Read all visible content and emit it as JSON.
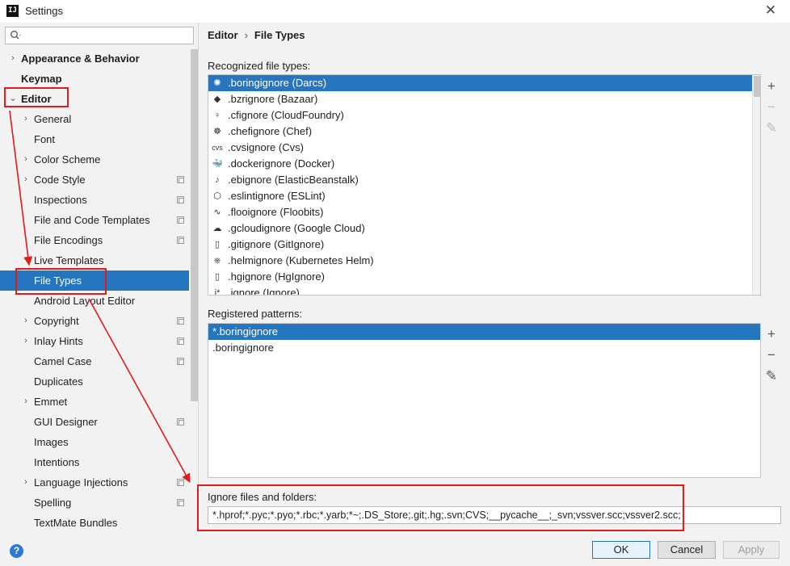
{
  "window": {
    "title": "Settings",
    "app_icon_text": "IJ"
  },
  "search": {
    "placeholder": ""
  },
  "sidebar": {
    "items": [
      {
        "label": "Appearance & Behavior",
        "arrow": "›",
        "bold": true
      },
      {
        "label": "Keymap",
        "bold": true
      },
      {
        "label": "Editor",
        "arrow": "⌄",
        "bold": true
      },
      {
        "label": "General",
        "arrow": "›"
      },
      {
        "label": "Font"
      },
      {
        "label": "Color Scheme",
        "arrow": "›"
      },
      {
        "label": "Code Style",
        "arrow": "›",
        "copy": true
      },
      {
        "label": "Inspections",
        "copy": true
      },
      {
        "label": "File and Code Templates",
        "copy": true
      },
      {
        "label": "File Encodings",
        "copy": true
      },
      {
        "label": "Live Templates"
      },
      {
        "label": "File Types",
        "selected": true
      },
      {
        "label": "Android Layout Editor"
      },
      {
        "label": "Copyright",
        "arrow": "›",
        "copy": true
      },
      {
        "label": "Inlay Hints",
        "arrow": "›",
        "copy": true
      },
      {
        "label": "Camel Case",
        "copy": true
      },
      {
        "label": "Duplicates"
      },
      {
        "label": "Emmet",
        "arrow": "›"
      },
      {
        "label": "GUI Designer",
        "copy": true
      },
      {
        "label": "Images"
      },
      {
        "label": "Intentions"
      },
      {
        "label": "Language Injections",
        "arrow": "›",
        "copy": true
      },
      {
        "label": "Spelling",
        "copy": true
      },
      {
        "label": "TextMate Bundles"
      }
    ]
  },
  "breadcrumb": {
    "parent": "Editor",
    "separator": "›",
    "current": "File Types"
  },
  "recognized": {
    "label": "Recognized file types:",
    "items": [
      {
        "icon": "✺",
        "icon_name": "darcs-icon",
        "label": ".boringignore (Darcs)",
        "selected": true
      },
      {
        "icon": "◆",
        "icon_name": "bazaar-icon",
        "label": ".bzrignore (Bazaar)"
      },
      {
        "icon": "♀",
        "icon_name": "cloudfoundry-icon",
        "label": ".cfignore (CloudFoundry)"
      },
      {
        "icon": "☸",
        "icon_name": "chef-icon",
        "label": ".chefignore (Chef)"
      },
      {
        "icon": "cvs",
        "icon_name": "cvs-icon",
        "label": ".cvsignore (Cvs)"
      },
      {
        "icon": "🐳",
        "icon_name": "docker-icon",
        "label": ".dockerignore (Docker)"
      },
      {
        "icon": "♪",
        "icon_name": "elasticbeanstalk-icon",
        "label": ".ebignore (ElasticBeanstalk)"
      },
      {
        "icon": "⬡",
        "icon_name": "eslint-icon",
        "label": ".eslintignore (ESLint)"
      },
      {
        "icon": "∿",
        "icon_name": "floobits-icon",
        "label": ".flooignore (Floobits)"
      },
      {
        "icon": "☁",
        "icon_name": "google-cloud-icon",
        "label": ".gcloudignore (Google Cloud)"
      },
      {
        "icon": "▯",
        "icon_name": "gitignore-icon",
        "label": ".gitignore (GitIgnore)"
      },
      {
        "icon": "⎈",
        "icon_name": "helm-icon",
        "label": ".helmignore (Kubernetes Helm)"
      },
      {
        "icon": "▯",
        "icon_name": "hgignore-icon",
        "label": ".hgignore (HgIgnore)"
      },
      {
        "icon": "i*",
        "icon_name": "ignore-icon",
        "label": ".ignore (Ignore)"
      }
    ]
  },
  "patterns": {
    "label": "Registered patterns:",
    "items": [
      {
        "label": "*.boringignore",
        "selected": true
      },
      {
        "label": ".boringignore"
      }
    ]
  },
  "tools": {
    "add": "+",
    "remove": "−",
    "edit": "✎"
  },
  "ignore": {
    "label": "Ignore files and folders:",
    "value": "*.hprof;*.pyc;*.pyo;*.rbc;*.yarb;*~;.DS_Store;.git;.hg;.svn;CVS;__pycache__;_svn;vssver.scc;vssver2.scc;"
  },
  "buttons": {
    "help": "?",
    "ok": "OK",
    "cancel": "Cancel",
    "apply": "Apply"
  },
  "colors": {
    "selection": "#2675bf",
    "annotation_red": "#e01b1b"
  }
}
